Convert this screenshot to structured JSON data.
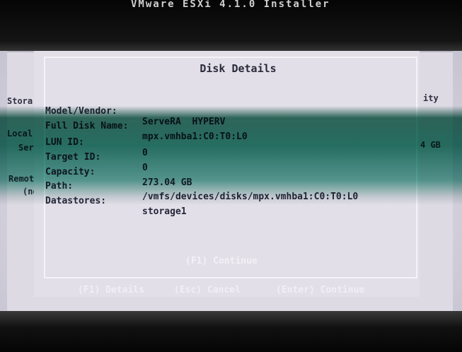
{
  "top_title": "VMware ESXi 4.1.0 Installer",
  "background": {
    "left_header": "Stora",
    "left_items": [
      "Local",
      "Ser",
      "Remot",
      "(no"
    ],
    "right_header": "ity",
    "right_value": "4 GB"
  },
  "dialog": {
    "title": "Disk Details",
    "fields": [
      {
        "label": "Model/Vendor:",
        "value": "ServeRA  HYPERV"
      },
      {
        "label": "Full Disk Name:",
        "value": "mpx.vmhba1:C0:T0:L0"
      },
      {
        "label": "LUN ID:",
        "value": "0"
      },
      {
        "label": "Target ID:",
        "value": "0"
      },
      {
        "label": "Capacity:",
        "value": "273.04 GB"
      },
      {
        "label": "Path:",
        "value": "/vmfs/devices/disks/mpx.vmhba1:C0:T0:L0"
      },
      {
        "label": "Datastores:",
        "value": "storage1"
      }
    ],
    "continue_label": "(F1) Continue"
  },
  "footer": {
    "details": "(F1) Details",
    "cancel": "(Esc) Cancel",
    "continue": "(Enter) Continue"
  }
}
